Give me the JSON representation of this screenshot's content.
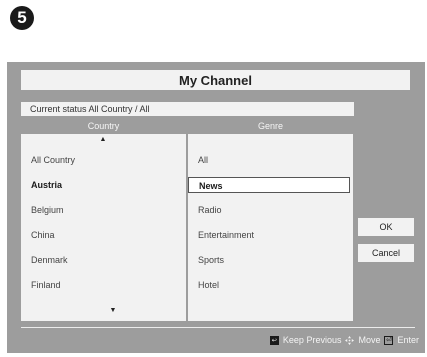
{
  "step_marker": "5",
  "dialog": {
    "title": "My Channel",
    "status_text": "Current status All Country / All"
  },
  "country": {
    "header": "Country",
    "items": [
      "All Country",
      "Austria",
      "Belgium",
      "China",
      "Denmark",
      "Finland"
    ],
    "highlighted": "Austria"
  },
  "genre": {
    "header": "Genre",
    "items": [
      "All",
      "News",
      "Radio",
      "Entertainment",
      "Sports",
      "Hotel"
    ],
    "selected": "News"
  },
  "buttons": {
    "ok": "OK",
    "cancel": "Cancel"
  },
  "help": {
    "keep_previous": "Keep Previous",
    "move": "Move",
    "enter": "Enter"
  },
  "icons": {
    "scroll_up": "arrow-up-icon",
    "scroll_down": "arrow-down-icon",
    "return": "return-icon",
    "move": "four-way-arrow-icon",
    "enter": "enter-icon"
  }
}
